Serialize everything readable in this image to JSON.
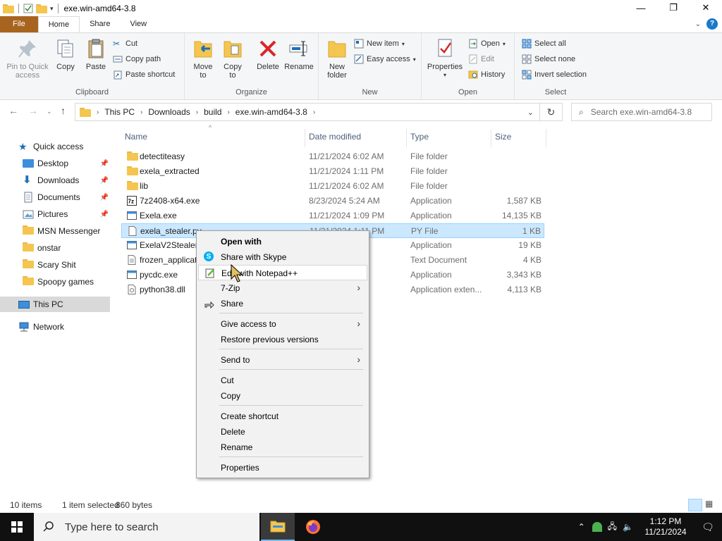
{
  "window": {
    "title": "exe.win-amd64-3.8",
    "minimize": "—",
    "maximize": "❐",
    "close": "✕"
  },
  "ribbon_tabs": [
    "File",
    "Home",
    "Share",
    "View"
  ],
  "ribbon": {
    "clipboard": {
      "label": "Clipboard",
      "pin": "Pin to Quick",
      "pin2": "access",
      "copy": "Copy",
      "paste": "Paste",
      "cut": "Cut",
      "copy_path": "Copy path",
      "paste_shortcut": "Paste shortcut"
    },
    "organize": {
      "label": "Organize",
      "move": "Move",
      "move2": "to",
      "copyto": "Copy",
      "copyto2": "to",
      "delete": "Delete",
      "rename": "Rename"
    },
    "new": {
      "label": "New",
      "new_folder": "New",
      "new_folder2": "folder",
      "new_item": "New item",
      "easy_access": "Easy access"
    },
    "open": {
      "label": "Open",
      "properties": "Properties",
      "open": "Open",
      "edit": "Edit",
      "history": "History"
    },
    "select": {
      "label": "Select",
      "select_all": "Select all",
      "select_none": "Select none",
      "invert": "Invert selection"
    }
  },
  "address": {
    "crumbs": [
      "This PC",
      "Downloads",
      "build",
      "exe.win-amd64-3.8"
    ],
    "search_placeholder": "Search exe.win-amd64-3.8"
  },
  "nav": {
    "quick_access": "Quick access",
    "items": [
      "Desktop",
      "Downloads",
      "Documents",
      "Pictures",
      "MSN Messenger",
      "onstar",
      "Scary Shit",
      "Spoopy games"
    ],
    "this_pc": "This PC",
    "network": "Network"
  },
  "columns": {
    "name": "Name",
    "date": "Date modified",
    "type": "Type",
    "size": "Size"
  },
  "files": [
    {
      "name": "detectiteasy",
      "date": "11/21/2024 6:02 AM",
      "type": "File folder",
      "size": ""
    },
    {
      "name": "exela_extracted",
      "date": "11/21/2024 1:11 PM",
      "type": "File folder",
      "size": ""
    },
    {
      "name": "lib",
      "date": "11/21/2024 6:02 AM",
      "type": "File folder",
      "size": ""
    },
    {
      "name": "7z2408-x64.exe",
      "date": "8/23/2024 5:24 AM",
      "type": "Application",
      "size": "1,587 KB"
    },
    {
      "name": "Exela.exe",
      "date": "11/21/2024 1:09 PM",
      "type": "Application",
      "size": "14,135 KB"
    },
    {
      "name": "exela_stealer.py",
      "date": "11/21/2024 1:11 PM",
      "type": "PY File",
      "size": "1 KB"
    },
    {
      "name": "ExelaV2StealerD",
      "date": "AM",
      "type": "Application",
      "size": "19 KB"
    },
    {
      "name": "frozen_applicat",
      "date": "PM",
      "type": "Text Document",
      "size": "4 KB"
    },
    {
      "name": "pycdc.exe",
      "date": "AM",
      "type": "Application",
      "size": "3,343 KB"
    },
    {
      "name": "python38.dll",
      "date": "M",
      "type": "Application exten...",
      "size": "4,113 KB"
    }
  ],
  "status": {
    "count": "10 items",
    "selected": "1 item selected",
    "size": "860 bytes"
  },
  "context_menu": {
    "open_with": "Open with",
    "share_skype": "Share with Skype",
    "edit_npp": "Edit with Notepad++",
    "sevenzip": "7-Zip",
    "share": "Share",
    "give_access": "Give access to",
    "restore": "Restore previous versions",
    "send_to": "Send to",
    "cut": "Cut",
    "copy": "Copy",
    "create_shortcut": "Create shortcut",
    "delete": "Delete",
    "rename": "Rename",
    "properties": "Properties"
  },
  "taskbar": {
    "search_placeholder": "Type here to search",
    "time": "1:12 PM",
    "date": "11/21/2024"
  },
  "colors": {
    "file_tab": "#a8641f",
    "selection": "#cce8ff",
    "taskbar": "#101010",
    "accent": "#1979ca"
  }
}
